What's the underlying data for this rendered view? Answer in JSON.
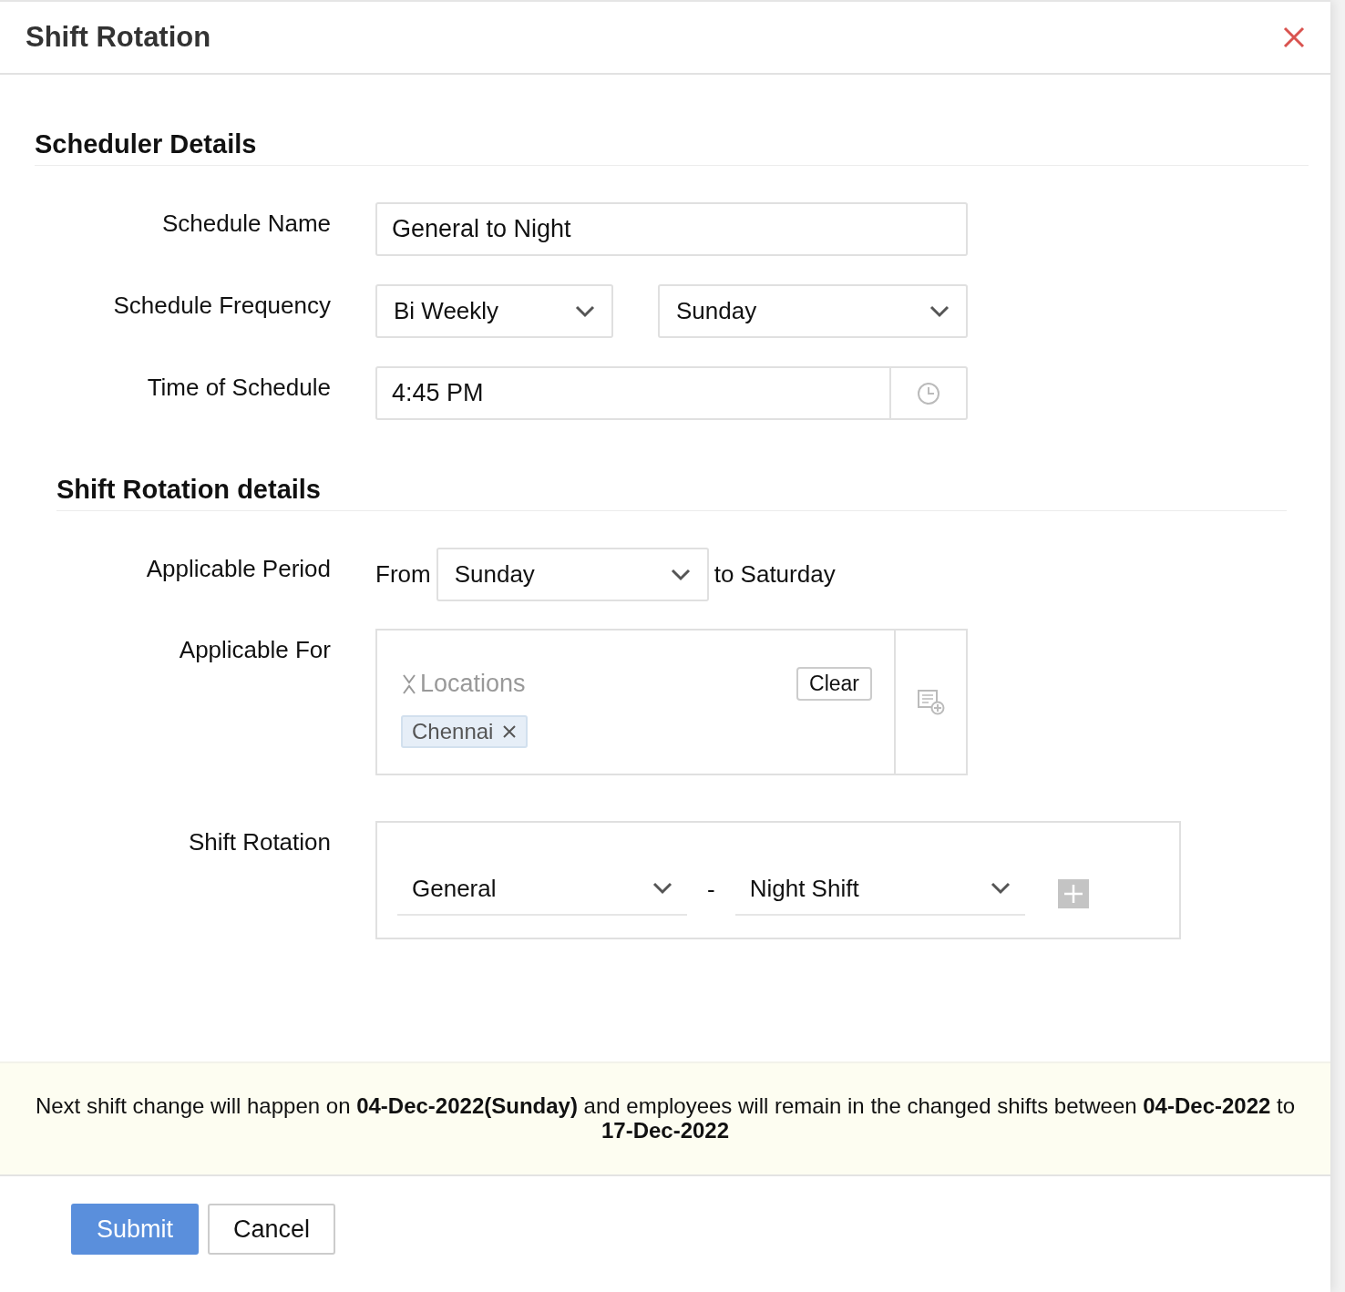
{
  "window": {
    "title": "Shift Rotation"
  },
  "scheduler_details": {
    "heading": "Scheduler Details",
    "schedule_name": {
      "label": "Schedule Name",
      "value": "General to Night"
    },
    "schedule_frequency": {
      "label": "Schedule Frequency",
      "frequency": "Bi Weekly",
      "day": "Sunday"
    },
    "time_of_schedule": {
      "label": "Time of Schedule",
      "value": "4:45 PM"
    }
  },
  "shift_rotation_details": {
    "heading": "Shift Rotation details",
    "applicable_period": {
      "label": "Applicable Period",
      "from_label": "From",
      "from": "Sunday",
      "to_text": "to Saturday"
    },
    "applicable_for": {
      "label": "Applicable For",
      "category": "Locations",
      "clear_button": "Clear",
      "chips": [
        "Chennai"
      ]
    },
    "shift_rotation": {
      "label": "Shift Rotation",
      "shifts": [
        "General",
        "Night Shift"
      ],
      "separator": "-"
    }
  },
  "notice": "Next shift change will happen on **04-Dec-2022(Sunday)** and employees will remain in the changed shifts between **04-Dec-2022** to **17-Dec-2022**",
  "buttons": [
    {
      "label": "Submit",
      "kind": "primary"
    },
    {
      "label": "Cancel",
      "kind": "secondary"
    }
  ]
}
